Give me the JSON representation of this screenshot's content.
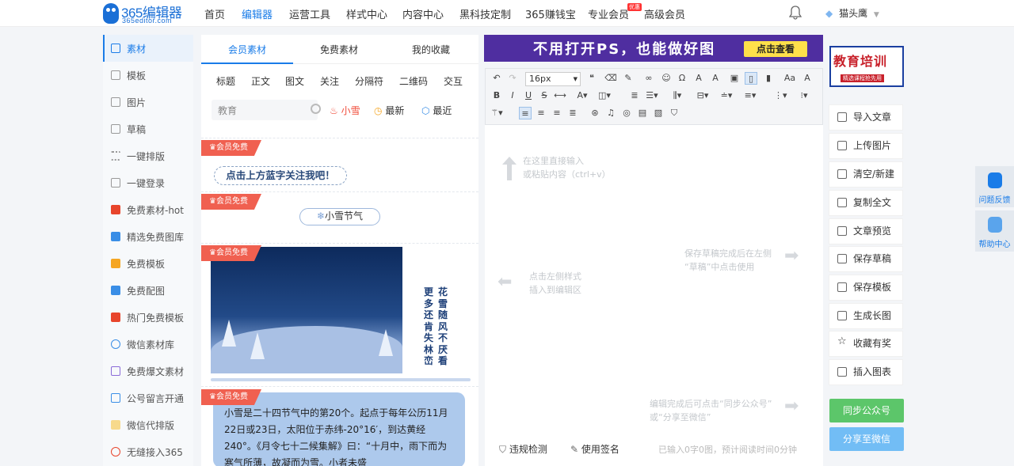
{
  "logo": {
    "name": "365编辑器",
    "sub": "365editor.com"
  },
  "nav": {
    "items": [
      "首页",
      "编辑器",
      "运营工具",
      "样式中心",
      "内容中心",
      "黑科技定制",
      "365赚钱宝",
      "专业会员",
      "高级会员"
    ],
    "hot_badge": "优惠",
    "username": "猫头鹰",
    "colors": {
      "active": "#1a7ce8"
    }
  },
  "sidebar": {
    "items": [
      {
        "label": "素材",
        "icon": "folder-icon"
      },
      {
        "label": "模板",
        "icon": "template-icon"
      },
      {
        "label": "图片",
        "icon": "image-icon"
      },
      {
        "label": "草稿",
        "icon": "draft-icon"
      },
      {
        "label": "一键排版",
        "icon": "list-icon"
      },
      {
        "label": "一键登录",
        "icon": "login-icon"
      },
      {
        "label": "免费素材-hot",
        "icon": "red-image-icon"
      },
      {
        "label": "精选免费图库",
        "icon": "blue-image-icon"
      },
      {
        "label": "免费模板",
        "icon": "orange-image-icon"
      },
      {
        "label": "免费配图",
        "icon": "blue-image-icon"
      },
      {
        "label": "热门免费模板",
        "icon": "red-image-icon"
      },
      {
        "label": "微信素材库",
        "icon": "wechat-icon"
      },
      {
        "label": "免费爆文素材",
        "icon": "purple-image-icon"
      },
      {
        "label": "公号留言开通",
        "icon": "cube-icon"
      },
      {
        "label": "微信代排版",
        "icon": "doc-icon"
      },
      {
        "label": "无缝接入365",
        "icon": "red-circle-icon"
      }
    ]
  },
  "material": {
    "tabs": [
      "会员素材",
      "免费素材",
      "我的收藏"
    ],
    "categories": [
      "标题",
      "正文",
      "图文",
      "关注",
      "分隔符",
      "二维码",
      "交互"
    ],
    "search": {
      "value": "教育"
    },
    "filters": {
      "hot": "小雪",
      "newest": "最新",
      "recent": "最近"
    },
    "vip_badge": "会员免费",
    "banner_text": "点击上方蓝字关注我吧！",
    "snow_title": "小雪节气",
    "poem_cols": [
      "花雪随风不厌看",
      "更多还肯失林峦"
    ],
    "card_text": "小雪是二十四节气中的第20个。起点于每年公历11月22日或23日，太阳位于赤纬-20°16′，到达黄经240°。《月令七十二候集解》曰：“十月中，雨下而为寒气所薄，故凝而为雪。小者未盛"
  },
  "editor": {
    "promo_text": "不用打开PS，也能做好图",
    "promo_button": "点击查看",
    "font_size": "16px",
    "hint_top": [
      "在这里直接输入",
      "或粘贴内容（ctrl+v）"
    ],
    "hint_left": [
      "点击左侧样式",
      "插入到编辑区"
    ],
    "hint_right": [
      "保存草稿完成后在左侧",
      "“草稿”中点击使用"
    ],
    "hint_bottom": [
      "编辑完成后可点击“同步公众号”",
      "或“分享至微信”"
    ],
    "check_label": "违规检测",
    "sign_label": "使用签名",
    "status": "已输入0字0图，预计阅读时间0分钟"
  },
  "right": {
    "ad": {
      "title": "教育培训",
      "sub": "精选课程抢先用"
    },
    "actions": [
      "导入文章",
      "上传图片",
      "清空/新建",
      "复制全文",
      "文章预览",
      "保存草稿",
      "保存模板",
      "生成长图",
      "收藏有奖",
      "插入图表"
    ],
    "sync_button": "同步公众号",
    "share_button": "分享至微信"
  },
  "float": {
    "feedback": "问题反馈",
    "help": "帮助中心"
  }
}
